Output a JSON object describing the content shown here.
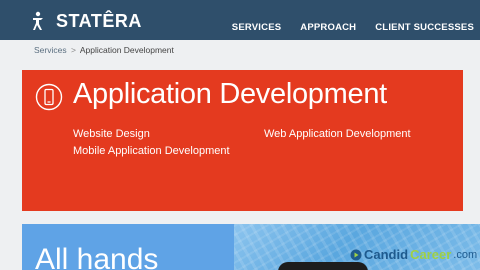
{
  "header": {
    "logo_text": "STATÊRA",
    "nav": [
      "SERVICES",
      "APPROACH",
      "CLIENT SUCCESSES"
    ]
  },
  "breadcrumb": {
    "link": "Services",
    "separator": ">",
    "current": "Application Development"
  },
  "card": {
    "title": "Application Development",
    "links": [
      "Website Design",
      "Mobile Application Development",
      "Web Application Development"
    ],
    "color": "#e43a1f"
  },
  "hero": {
    "text": "All hands"
  },
  "watermark": {
    "part1": "Candid",
    "part2": "Career",
    "part3": ".com"
  },
  "colors": {
    "header": "#2f4f6b",
    "accent": "#e43a1f",
    "hero_left": "#5fa3e6"
  }
}
